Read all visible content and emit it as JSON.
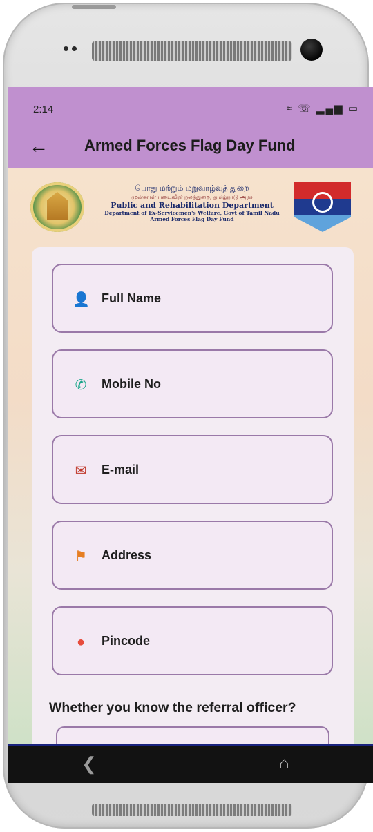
{
  "status_bar": {
    "time": "2:14",
    "icons": [
      "wifi-icon",
      "call-icon",
      "signal-icon",
      "battery-icon"
    ]
  },
  "app_bar": {
    "title": "Armed Forces Flag Day Fund",
    "back_icon": "arrow-left-icon"
  },
  "header": {
    "line_tamil_1": "பொது மற்றும் மறுவாழ்வுத் துறை",
    "line_tamil_2": "முன்னாள் படைவீரர் நலத்துறை, தமிழ்நாடு அரசு",
    "line_english_1": "Public and Rehabilitation Department",
    "line_english_2": "Department of Ex-Servicemen's Welfare, Govt of Tamil Nadu",
    "line_english_3": "Armed Forces Flag Day Fund"
  },
  "form": {
    "fields": [
      {
        "label": "Full Name",
        "icon": "person-icon"
      },
      {
        "label": "Mobile No",
        "icon": "phone-icon"
      },
      {
        "label": "E-mail",
        "icon": "mail-icon"
      },
      {
        "label": "Address",
        "icon": "location-map-icon"
      },
      {
        "label": "Pincode",
        "icon": "location-pin-icon"
      }
    ],
    "question": "Whether you know the referral officer?"
  },
  "nav_bar": {
    "back_icon": "nav-back-icon",
    "home_icon": "nav-home-icon"
  },
  "colors": {
    "app_bar": "#c090cf",
    "field_border": "#9a79a8",
    "field_background": "#f3e9f4"
  }
}
